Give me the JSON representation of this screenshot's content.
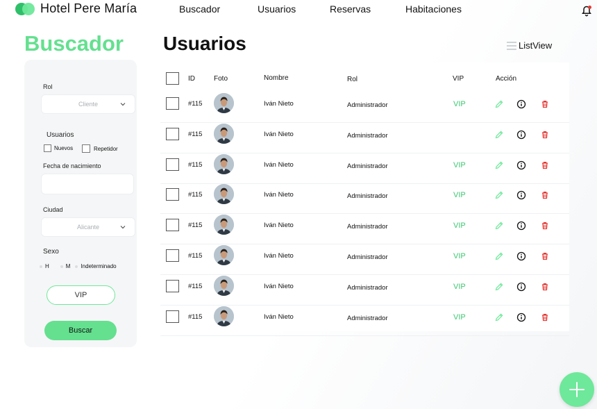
{
  "brand": {
    "name": "Hotel Pere María",
    "accent": "#64e08f"
  },
  "nav": [
    {
      "label": "Buscador"
    },
    {
      "label": "Usuarios"
    },
    {
      "label": "Reservas"
    },
    {
      "label": "Habitaciones"
    }
  ],
  "notification_icon": "bell-icon",
  "sidebar": {
    "title": "Buscador",
    "rol_label": "Rol",
    "rol_value": "Cliente",
    "usuarios_label": "Usuarios",
    "usuarios_options": [
      "Nuevos",
      "Repetidor"
    ],
    "fecha_label": "Fecha de nacimiento",
    "fecha_value": "",
    "ciudad_label": "Ciudad",
    "ciudad_value": "Alicante",
    "sexo_label": "Sexo",
    "sexo_options": [
      "H",
      "M",
      "Indeterminado"
    ],
    "vip_label": "VIP",
    "search_label": "Buscar"
  },
  "main": {
    "title": "Usuarios",
    "view_label": "ListView",
    "columns": {
      "id": "ID",
      "foto": "Foto",
      "nombre": "Nombre",
      "rol": "Rol",
      "vip": "VIP",
      "accion": "Acción"
    },
    "rows": [
      {
        "id": "#115",
        "nombre": "Iván Nieto",
        "rol": "Administrador",
        "vip": "VIP"
      },
      {
        "id": "#115",
        "nombre": "Iván Nieto",
        "rol": "Administrador",
        "vip": ""
      },
      {
        "id": "#115",
        "nombre": "Iván Nieto",
        "rol": "Administrador",
        "vip": "VIP"
      },
      {
        "id": "#115",
        "nombre": "Iván Nieto",
        "rol": "Administrador",
        "vip": "VIP"
      },
      {
        "id": "#115",
        "nombre": "Iván Nieto",
        "rol": "Administrador",
        "vip": "VIP"
      },
      {
        "id": "#115",
        "nombre": "Iván Nieto",
        "rol": "Administrador",
        "vip": "VIP"
      },
      {
        "id": "#115",
        "nombre": "Iván Nieto",
        "rol": "Administrador",
        "vip": "VIP"
      },
      {
        "id": "#115",
        "nombre": "Iván Nieto",
        "rol": "Administrador",
        "vip": "VIP"
      }
    ],
    "row_actions": [
      "edit-icon",
      "info-icon",
      "delete-icon"
    ]
  },
  "fab_icon": "plus-icon",
  "colors": {
    "accent": "#64e08f",
    "vip_text": "#3ec774",
    "delete": "#e53935"
  }
}
